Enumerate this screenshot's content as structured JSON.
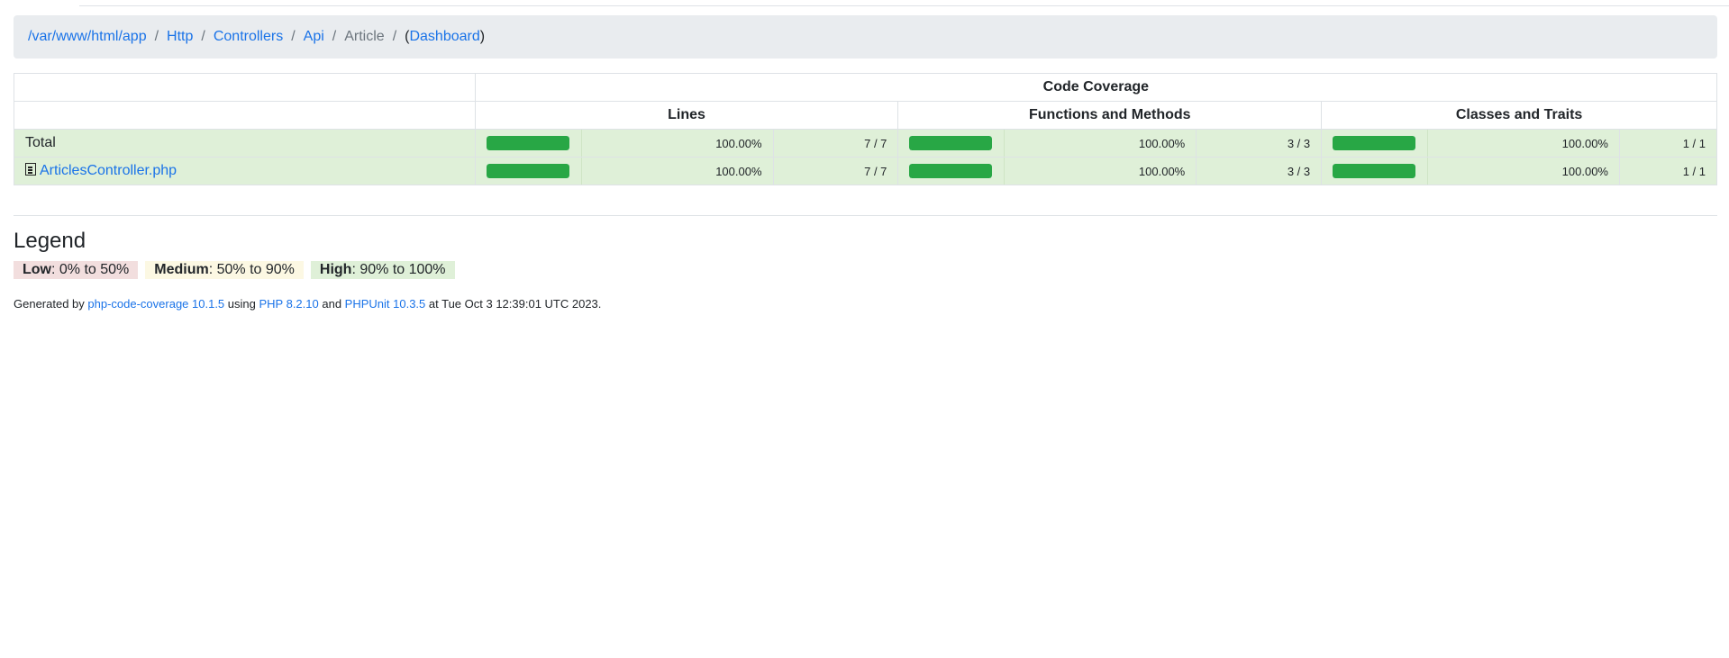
{
  "breadcrumb": {
    "items": [
      {
        "label": "/var/www/html/app",
        "link": true
      },
      {
        "label": "Http",
        "link": true
      },
      {
        "label": "Controllers",
        "link": true
      },
      {
        "label": "Api",
        "link": true
      },
      {
        "label": "Article",
        "link": false
      }
    ],
    "dashboard_label": "Dashboard",
    "open_paren": "(",
    "close_paren": ")"
  },
  "table": {
    "code_coverage_header": "Code Coverage",
    "columns": [
      "Lines",
      "Functions and Methods",
      "Classes and Traits"
    ],
    "rows": [
      {
        "name": "Total",
        "is_file": false,
        "lines": {
          "percent": "100.00%",
          "ratio": "7 / 7",
          "fill": 1.0
        },
        "functions": {
          "percent": "100.00%",
          "ratio": "3 / 3",
          "fill": 1.0
        },
        "classes": {
          "percent": "100.00%",
          "ratio": "1 / 1",
          "fill": 1.0
        }
      },
      {
        "name": "ArticlesController.php",
        "is_file": true,
        "lines": {
          "percent": "100.00%",
          "ratio": "7 / 7",
          "fill": 1.0
        },
        "functions": {
          "percent": "100.00%",
          "ratio": "3 / 3",
          "fill": 1.0
        },
        "classes": {
          "percent": "100.00%",
          "ratio": "1 / 1",
          "fill": 1.0
        }
      }
    ],
    "bar_color": "#28a745",
    "row_color": "#dff0d8"
  },
  "legend": {
    "title": "Legend",
    "low": {
      "label": "Low",
      "range": ": 0% to 50%"
    },
    "medium": {
      "label": "Medium",
      "range": ": 50% to 90%"
    },
    "high": {
      "label": "High",
      "range": ": 90% to 100%"
    }
  },
  "footer": {
    "generated_by": "Generated by ",
    "tool_link": "php-code-coverage 10.1.5",
    "using": " using ",
    "php_link": "PHP 8.2.10",
    "and": " and ",
    "phpunit_link": "PHPUnit 10.3.5",
    "at": " at Tue Oct 3 12:39:01 UTC 2023."
  }
}
